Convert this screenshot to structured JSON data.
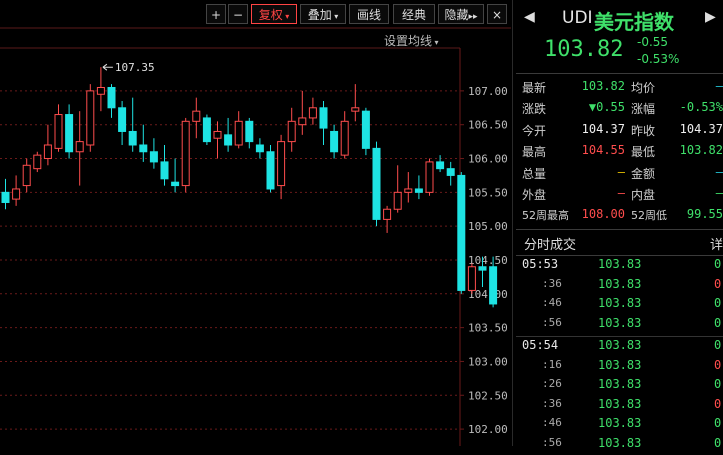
{
  "toolbar": {
    "plus": "+",
    "minus": "−",
    "restore": "复权",
    "overlay": "叠加",
    "draw_line": "画线",
    "classic": "经典",
    "hide": "隐藏",
    "more": "▸▸",
    "close": "×",
    "ma_setting": "设置均线"
  },
  "chart_data": {
    "type": "candlestick",
    "y_ticks": [
      "107.00",
      "106.50",
      "106.00",
      "105.50",
      "105.00",
      "104.50",
      "104.00",
      "103.50",
      "103.00",
      "102.50",
      "102.00"
    ],
    "ylim": [
      101.75,
      107.9
    ],
    "max_label": "107.35",
    "candles": [
      {
        "o": 105.5,
        "c": 105.35,
        "h": 105.7,
        "l": 105.25
      },
      {
        "o": 105.4,
        "c": 105.55,
        "h": 105.75,
        "l": 105.3
      },
      {
        "o": 105.6,
        "c": 105.9,
        "h": 106.0,
        "l": 105.5
      },
      {
        "o": 105.85,
        "c": 106.05,
        "h": 106.1,
        "l": 105.8
      },
      {
        "o": 106.0,
        "c": 106.2,
        "h": 106.5,
        "l": 105.9
      },
      {
        "o": 106.15,
        "c": 106.65,
        "h": 106.8,
        "l": 106.1
      },
      {
        "o": 106.65,
        "c": 106.1,
        "h": 106.8,
        "l": 106.0
      },
      {
        "o": 106.1,
        "c": 106.25,
        "h": 106.7,
        "l": 105.6
      },
      {
        "o": 106.2,
        "c": 107.0,
        "h": 107.1,
        "l": 106.1
      },
      {
        "o": 106.95,
        "c": 107.05,
        "h": 107.35,
        "l": 106.7
      },
      {
        "o": 107.05,
        "c": 106.75,
        "h": 107.1,
        "l": 106.6
      },
      {
        "o": 106.75,
        "c": 106.4,
        "h": 106.85,
        "l": 106.2
      },
      {
        "o": 106.4,
        "c": 106.2,
        "h": 106.9,
        "l": 106.1
      },
      {
        "o": 106.2,
        "c": 106.1,
        "h": 106.5,
        "l": 105.95
      },
      {
        "o": 106.1,
        "c": 105.95,
        "h": 106.3,
        "l": 105.85
      },
      {
        "o": 105.95,
        "c": 105.7,
        "h": 106.2,
        "l": 105.6
      },
      {
        "o": 105.65,
        "c": 105.6,
        "h": 106.0,
        "l": 105.5
      },
      {
        "o": 105.6,
        "c": 106.55,
        "h": 106.6,
        "l": 105.5
      },
      {
        "o": 106.55,
        "c": 106.7,
        "h": 106.9,
        "l": 106.3
      },
      {
        "o": 106.6,
        "c": 106.25,
        "h": 106.65,
        "l": 106.2
      },
      {
        "o": 106.3,
        "c": 106.4,
        "h": 106.55,
        "l": 106.0
      },
      {
        "o": 106.35,
        "c": 106.2,
        "h": 106.6,
        "l": 106.1
      },
      {
        "o": 106.2,
        "c": 106.55,
        "h": 106.7,
        "l": 106.15
      },
      {
        "o": 106.55,
        "c": 106.25,
        "h": 106.6,
        "l": 106.15
      },
      {
        "o": 106.2,
        "c": 106.1,
        "h": 106.3,
        "l": 106.0
      },
      {
        "o": 106.1,
        "c": 105.55,
        "h": 106.2,
        "l": 105.5
      },
      {
        "o": 105.6,
        "c": 106.25,
        "h": 106.35,
        "l": 105.4
      },
      {
        "o": 106.25,
        "c": 106.55,
        "h": 106.75,
        "l": 106.1
      },
      {
        "o": 106.5,
        "c": 106.6,
        "h": 107.0,
        "l": 106.35
      },
      {
        "o": 106.6,
        "c": 106.75,
        "h": 106.9,
        "l": 106.5
      },
      {
        "o": 106.75,
        "c": 106.45,
        "h": 106.85,
        "l": 106.2
      },
      {
        "o": 106.4,
        "c": 106.1,
        "h": 106.5,
        "l": 106.0
      },
      {
        "o": 106.05,
        "c": 106.55,
        "h": 106.7,
        "l": 106.0
      },
      {
        "o": 106.7,
        "c": 106.75,
        "h": 107.1,
        "l": 106.55
      },
      {
        "o": 106.7,
        "c": 106.15,
        "h": 106.75,
        "l": 106.05
      },
      {
        "o": 106.15,
        "c": 105.1,
        "h": 106.25,
        "l": 105.0
      },
      {
        "o": 105.1,
        "c": 105.25,
        "h": 105.3,
        "l": 104.9
      },
      {
        "o": 105.25,
        "c": 105.5,
        "h": 105.9,
        "l": 105.2
      },
      {
        "o": 105.5,
        "c": 105.55,
        "h": 105.8,
        "l": 105.35
      },
      {
        "o": 105.55,
        "c": 105.5,
        "h": 105.75,
        "l": 105.4
      },
      {
        "o": 105.5,
        "c": 105.95,
        "h": 106.0,
        "l": 105.45
      },
      {
        "o": 105.95,
        "c": 105.85,
        "h": 106.05,
        "l": 105.8
      },
      {
        "o": 105.85,
        "c": 105.75,
        "h": 105.95,
        "l": 105.6
      },
      {
        "o": 105.75,
        "c": 104.05,
        "h": 105.8,
        "l": 104.0
      },
      {
        "o": 104.05,
        "c": 104.4,
        "h": 104.45,
        "l": 104.0
      },
      {
        "o": 104.4,
        "c": 104.35,
        "h": 104.55,
        "l": 104.1
      },
      {
        "o": 104.4,
        "c": 103.85,
        "h": 104.55,
        "l": 103.8
      }
    ]
  },
  "quote": {
    "symbol": "UDI",
    "name": "美元指数",
    "price": "103.82",
    "change": "-0.55",
    "change_pct": "-0.53%"
  },
  "stats": [
    {
      "label": "最新",
      "value": "103.82",
      "color": "green",
      "label2": "均价",
      "value2": "—",
      "color2": "cyan"
    },
    {
      "label": "涨跌",
      "value": "▼0.55",
      "color": "green",
      "label2": "涨幅",
      "value2": "-0.53%",
      "color2": "green"
    },
    {
      "label": "今开",
      "value": "104.37",
      "color": "white",
      "label2": "昨收",
      "value2": "104.37",
      "color2": "white"
    },
    {
      "label": "最高",
      "value": "104.55",
      "color": "red",
      "label2": "最低",
      "value2": "103.82",
      "color2": "green"
    },
    {
      "label": "总量",
      "value": "—",
      "color": "yellow",
      "label2": "金额",
      "value2": "—",
      "color2": "cyan"
    },
    {
      "label": "外盘",
      "value": "—",
      "color": "red",
      "label2": "内盘",
      "value2": "—",
      "color2": "green"
    },
    {
      "label": "52周最高",
      "value": "108.00",
      "color": "red",
      "label2": "52周低",
      "value2": "99.55",
      "color2": "green"
    }
  ],
  "trades_header": {
    "title": "分时成交",
    "detail": "详"
  },
  "trades": [
    {
      "time": "05:53",
      "price": "103.83",
      "vol": "0",
      "vcolor": "green"
    },
    {
      "time": ":36",
      "price": "103.83",
      "vol": "0",
      "vcolor": "red"
    },
    {
      "time": ":46",
      "price": "103.83",
      "vol": "0",
      "vcolor": "green"
    },
    {
      "time": ":56",
      "price": "103.83",
      "vol": "0",
      "vcolor": "green"
    },
    {
      "time": "05:54",
      "price": "103.83",
      "vol": "0",
      "vcolor": "green"
    },
    {
      "time": ":16",
      "price": "103.83",
      "vol": "0",
      "vcolor": "red"
    },
    {
      "time": ":26",
      "price": "103.83",
      "vol": "0",
      "vcolor": "green"
    },
    {
      "time": ":36",
      "price": "103.83",
      "vol": "0",
      "vcolor": "red"
    },
    {
      "time": ":46",
      "price": "103.83",
      "vol": "0",
      "vcolor": "green"
    },
    {
      "time": ":56",
      "price": "103.83",
      "vol": "0",
      "vcolor": "green"
    }
  ],
  "colors": {
    "up": "#ff4d4d",
    "down": "#1ee3e3",
    "grid": "#6a1a1a",
    "axis_text": "#bdbdbd"
  }
}
